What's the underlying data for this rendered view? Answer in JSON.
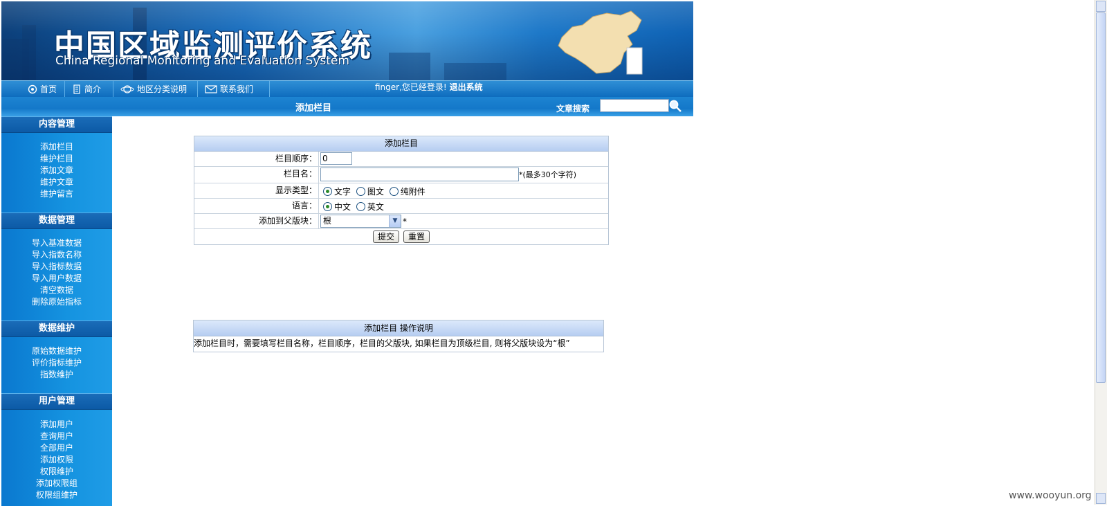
{
  "banner": {
    "title_cn": "中国区域监测评价系统",
    "title_en": "China Regional Monitoring and Evaluation System"
  },
  "nav": {
    "items": [
      {
        "label": "首页",
        "icon": "home-icon"
      },
      {
        "label": "简介",
        "icon": "document-icon"
      },
      {
        "label": "地区分类说明",
        "icon": "globe-icon"
      },
      {
        "label": "联系我们",
        "icon": "mail-icon"
      }
    ],
    "login_text": "finger,您已经登录!",
    "logout_label": "退出系统"
  },
  "titlebar": {
    "page_title": "添加栏目",
    "search_label": "文章搜索",
    "search_value": ""
  },
  "sidebar": {
    "sections": [
      {
        "title": "内容管理",
        "items": [
          "添加栏目",
          "维护栏目",
          "添加文章",
          "维护文章",
          "维护留言"
        ]
      },
      {
        "title": "数据管理",
        "items": [
          "导入基准数据",
          "导入指数名称",
          "导入指标数据",
          "导入用户数据",
          "清空数据",
          "删除原始指标"
        ]
      },
      {
        "title": "数据维护",
        "items": [
          "原始数据维护",
          "评价指标维护",
          "指数维护"
        ]
      },
      {
        "title": "用户管理",
        "items": [
          "添加用户",
          "查询用户",
          "全部用户",
          "添加权限",
          "权限维护",
          "添加权限组",
          "权限组维护"
        ]
      }
    ]
  },
  "form": {
    "header": "添加栏目",
    "order_label": "栏目顺序：",
    "order_value": "0",
    "name_label": "栏目名：",
    "name_value": "",
    "name_hint": "*(最多30个字符)",
    "display_label": "显示类型：",
    "display_options": [
      "文字",
      "图文",
      "纯附件"
    ],
    "display_selected": 0,
    "lang_label": "语言：",
    "lang_options": [
      "中文",
      "英文"
    ],
    "lang_selected": 0,
    "parent_label": "添加到父版块：",
    "parent_value": "根",
    "parent_required": "*",
    "submit_label": "提交",
    "reset_label": "重置"
  },
  "help": {
    "header": "添加栏目 操作说明",
    "text": "添加栏目时，需要填写栏目名称，栏目顺序，栏目的父版块, 如果栏目为顶级栏目, 则将父版块设为“根”"
  },
  "watermark": "www.wooyun.org",
  "colors": {
    "banner_blue": "#1a6fbf",
    "sidebar_blue": "#1593e0",
    "table_header": "#b6cdf1"
  }
}
